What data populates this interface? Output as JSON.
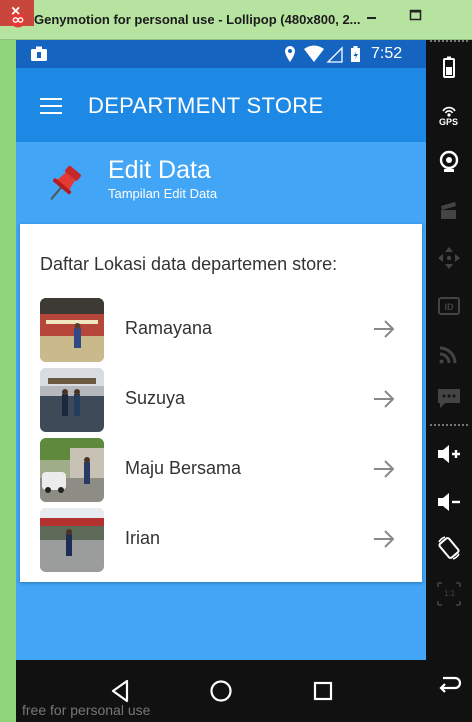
{
  "window": {
    "title": "Genymotion for personal use - Lollipop (480x800, 2...",
    "minimize": "–",
    "maximize": "☐",
    "close": "×"
  },
  "status_bar": {
    "time": "7:52"
  },
  "app_bar": {
    "title": "DEPARTMENT STORE"
  },
  "header": {
    "title": "Edit Data",
    "subtitle": "Tampilan Edit Data"
  },
  "list": {
    "title": "Daftar Lokasi data departemen store:",
    "items": [
      {
        "label": "Ramayana"
      },
      {
        "label": "Suzuya"
      },
      {
        "label": "Maju Bersama"
      },
      {
        "label": "Irian"
      }
    ]
  },
  "nav_bar": {
    "watermark": "free for personal use"
  },
  "sidebar": {
    "gps_label": "GPS",
    "ratio_label": "1:1"
  },
  "colors": {
    "status_bar": "#1565c0",
    "app_bar": "#1e88e5",
    "content_bg": "#42a5f5",
    "titlebar": "#b7e3a0",
    "close_button": "#c9463d"
  }
}
